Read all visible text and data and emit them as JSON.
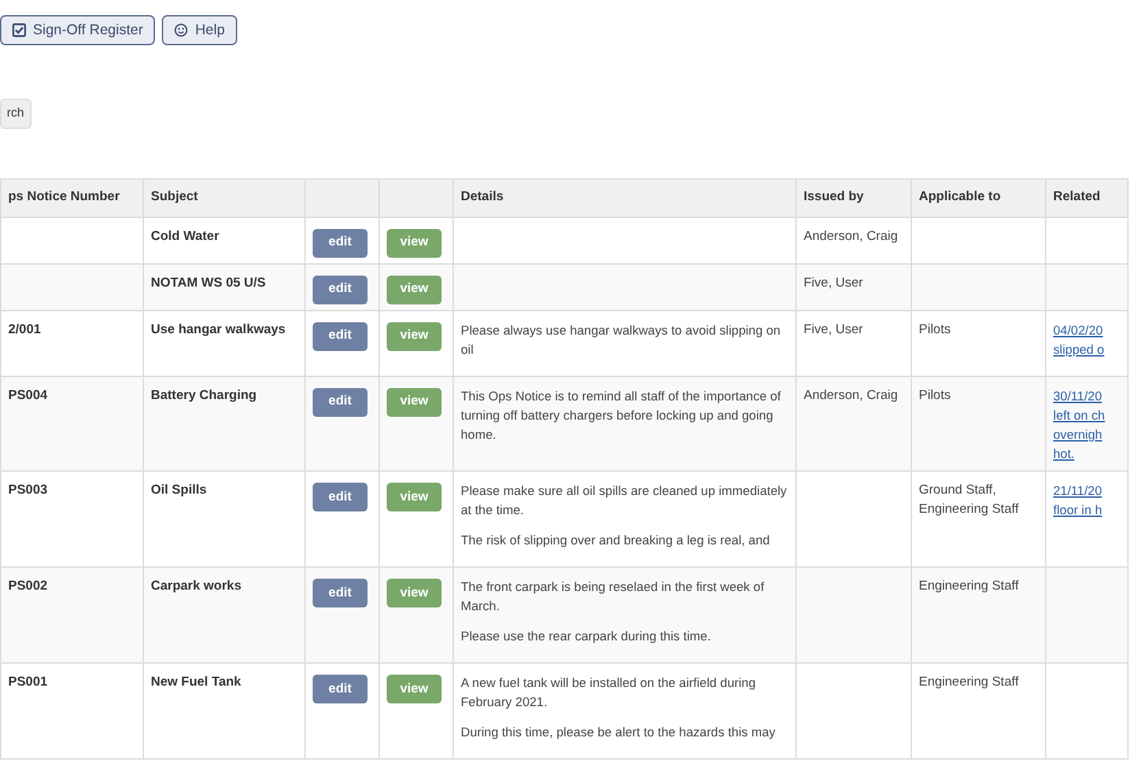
{
  "toolbar": {
    "buttons": [
      {
        "label": "Sign-Off Register"
      },
      {
        "label": "Help"
      }
    ]
  },
  "search_button": {
    "label": "rch"
  },
  "table": {
    "columns": [
      "ps Notice Number",
      "Subject",
      "",
      "",
      "Details",
      "Issued by",
      "Applicable to",
      "Related"
    ],
    "rows": [
      {
        "number": "",
        "subject": "Cold Water",
        "edit": "edit",
        "view": "view",
        "details": [],
        "issued_by": "Anderson, Craig",
        "applicable_to": [],
        "related": []
      },
      {
        "number": "",
        "subject": "NOTAM WS 05 U/S",
        "edit": "edit",
        "view": "view",
        "details": [],
        "issued_by": "Five, User",
        "applicable_to": [],
        "related": []
      },
      {
        "number": "2/001",
        "subject": "Use hangar walkways",
        "edit": "edit",
        "view": "view",
        "details": [
          "Please always use hangar walkways to avoid slipping on oil"
        ],
        "issued_by": "Five, User",
        "applicable_to": [
          "Pilots"
        ],
        "related": [
          "04/02/20",
          "slipped o"
        ]
      },
      {
        "number": "PS004",
        "subject": "Battery Charging",
        "edit": "edit",
        "view": "view",
        "details": [
          "This Ops Notice is to remind all staff of the importance of turning off battery chargers before locking up and going home."
        ],
        "issued_by": "Anderson, Craig",
        "applicable_to": [
          "Pilots"
        ],
        "related": [
          "30/11/20",
          "left on ch",
          "overnigh",
          "hot."
        ]
      },
      {
        "number": "PS003",
        "subject": "Oil Spills",
        "edit": "edit",
        "view": "view",
        "details": [
          "Please make sure all oil spills are cleaned up immediately at the time.",
          "The risk of slipping over and breaking a leg is real, and"
        ],
        "issued_by": "",
        "applicable_to": [
          "Ground Staff,",
          "Engineering Staff"
        ],
        "related": [
          "21/11/20",
          "floor in h"
        ]
      },
      {
        "number": "PS002",
        "subject": "Carpark works",
        "edit": "edit",
        "view": "view",
        "details": [
          "The front carpark is being reselaed in the first week of March.",
          "Please use the rear carpark during this time."
        ],
        "issued_by": "",
        "applicable_to": [
          "Engineering Staff"
        ],
        "related": []
      },
      {
        "number": "PS001",
        "subject": "New Fuel Tank",
        "edit": "edit",
        "view": "view",
        "details": [
          "A new fuel tank will be installed on the airfield during February 2021.",
          "During this time, please be alert to the hazards this may"
        ],
        "issued_by": "",
        "applicable_to": [
          "Engineering Staff"
        ],
        "related": []
      }
    ]
  }
}
